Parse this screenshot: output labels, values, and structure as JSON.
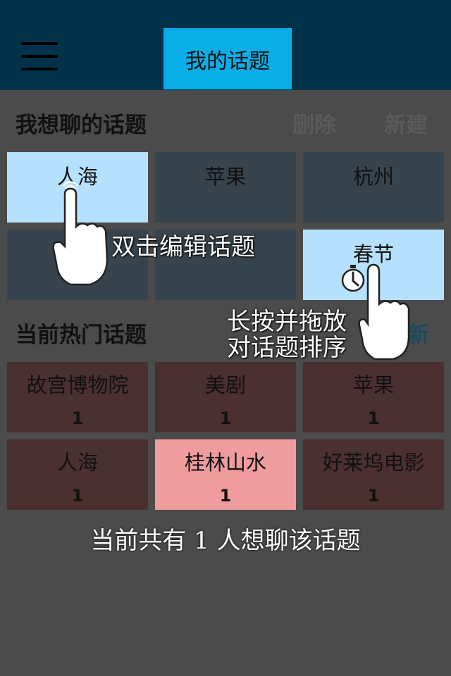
{
  "header": {
    "title": "我的话题"
  },
  "my_topics": {
    "title": "我想聊的话题",
    "delete_label": "删除",
    "new_label": "新建",
    "tiles": [
      {
        "label": "人海",
        "selected": true
      },
      {
        "label": "苹果",
        "selected": false
      },
      {
        "label": "杭州",
        "selected": false
      },
      {
        "label": "",
        "selected": false
      },
      {
        "label": "",
        "selected": false
      },
      {
        "label": "春节",
        "selected": true
      }
    ]
  },
  "hot_topics": {
    "title": "当前热门话题",
    "refresh_label": "新",
    "tiles": [
      {
        "label": "故宫博物院",
        "count": "1"
      },
      {
        "label": "美剧",
        "count": "1"
      },
      {
        "label": "苹果",
        "count": "1"
      },
      {
        "label": "人海",
        "count": "1"
      },
      {
        "label": "桂林山水",
        "count": "1"
      },
      {
        "label": "好莱坞电影",
        "count": "1"
      }
    ]
  },
  "hints": {
    "double_tap": "双击编辑话题",
    "long_press_line1": "长按并拖放",
    "long_press_line2": "对话题排序"
  },
  "footer": {
    "text": "当前共有 1 人想聊该话题"
  },
  "colors": {
    "header_bg": "#013249",
    "tab_bg": "#0aaee7",
    "tile_dark": "#37444e",
    "tile_selected": "#b5e1fc",
    "hot_tile": "#4a3031",
    "hot_active": "#ef9c9f"
  }
}
